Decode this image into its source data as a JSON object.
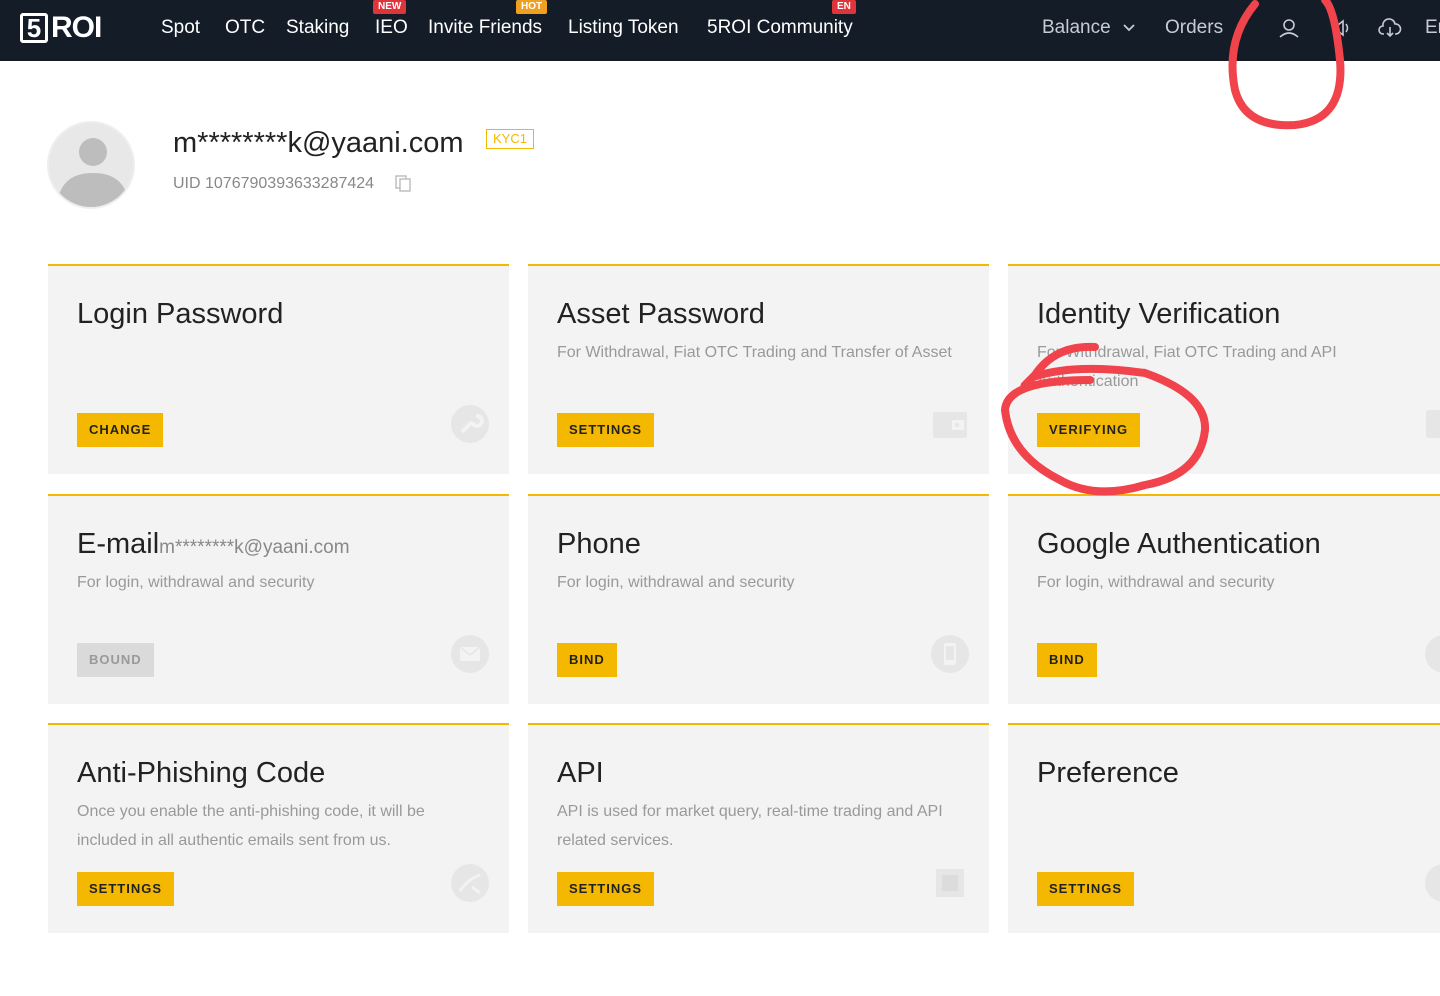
{
  "brand": {
    "logo_digit": "5",
    "logo_text": "ROI"
  },
  "nav": {
    "items": [
      {
        "label": "Spot"
      },
      {
        "label": "OTC"
      },
      {
        "label": "Staking"
      },
      {
        "label": "IEO",
        "badge": "NEW"
      },
      {
        "label": "Invite Friends",
        "badge": "HOT"
      },
      {
        "label": "Listing Token"
      },
      {
        "label": "5ROI Community",
        "badge": "EN"
      }
    ],
    "balance": "Balance",
    "orders": "Orders",
    "lang_partial": "Er",
    "icons": [
      "user-icon",
      "speaker-icon",
      "cloud-download-icon"
    ]
  },
  "profile": {
    "email": "m********k@yaani.com",
    "kyc": "KYC1",
    "uid": "UID 1076790393633287424"
  },
  "cards": [
    {
      "title": "Login Password",
      "desc": "",
      "button": "CHANGE",
      "icon": "wrench-icon"
    },
    {
      "title": "Asset Password",
      "desc": "For Withdrawal, Fiat OTC Trading and Transfer of Asset",
      "button": "SETTINGS",
      "icon": "wallet-icon"
    },
    {
      "title": "Identity Verification",
      "desc": "For Withdrawal, Fiat OTC Trading and API Authentication",
      "button": "VERIFYING",
      "icon": "id-icon"
    },
    {
      "title": "E-mail",
      "title_suffix": "m********k@yaani.com",
      "desc": "For login, withdrawal and security",
      "button": "BOUND",
      "icon": "mail-icon"
    },
    {
      "title": "Phone",
      "desc": "For login, withdrawal and security",
      "button": "BIND",
      "icon": "phone-icon"
    },
    {
      "title": "Google Authentication",
      "desc": "For login, withdrawal and security",
      "button": "BIND",
      "icon": "google-icon"
    },
    {
      "title": "Anti-Phishing Code",
      "desc": "Once you enable the anti-phishing code, it will be included in all authentic emails sent from us.",
      "button": "SETTINGS",
      "icon": "anti-phishing-icon"
    },
    {
      "title": "API",
      "desc": "API is used for market query, real-time trading and API related services.",
      "button": "SETTINGS",
      "icon": "chip-icon"
    },
    {
      "title": "Preference",
      "desc": "",
      "button": "SETTINGS",
      "icon": "settings-icon"
    }
  ],
  "colors": {
    "accent": "#f5b800",
    "topbar": "#141c28",
    "annotation": "#f0434c",
    "badge_red": "#e0343b",
    "badge_orange": "#f0a020"
  }
}
